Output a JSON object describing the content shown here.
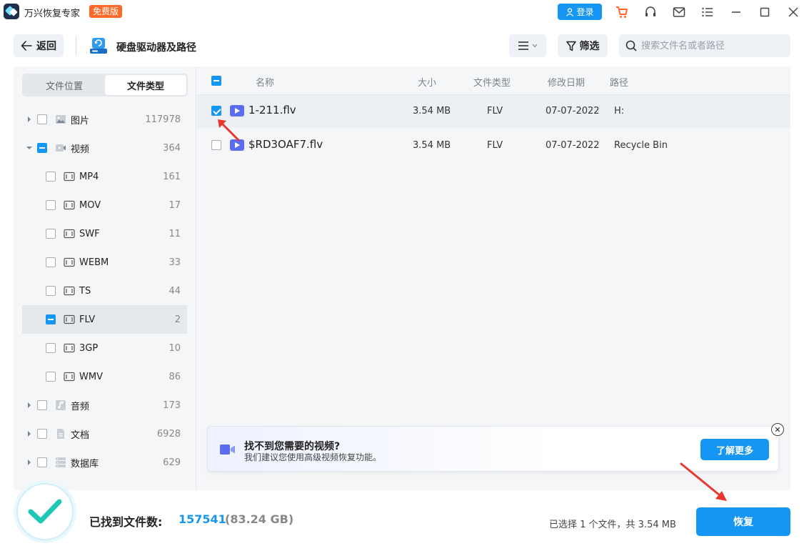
{
  "window": {
    "title": "万兴恢复专家",
    "badge": "免费版",
    "login_label": "登录"
  },
  "toolbar": {
    "back_label": "返回",
    "page_title": "硬盘驱动器及路径",
    "filter_label": "筛选",
    "search_placeholder": "搜索文件名或者路径"
  },
  "sidebar": {
    "tabs": [
      "文件位置",
      "文件类型"
    ],
    "active_tab": "文件类型",
    "tree": [
      {
        "label": "图片",
        "count": "117978",
        "level": 0,
        "state": "unchecked",
        "expanded": false,
        "icon": "image-icon"
      },
      {
        "label": "视频",
        "count": "364",
        "level": 0,
        "state": "partial",
        "expanded": true,
        "icon": "video-icon"
      },
      {
        "label": "MP4",
        "count": "161",
        "level": 1,
        "state": "unchecked",
        "icon": "video-file-icon"
      },
      {
        "label": "MOV",
        "count": "17",
        "level": 1,
        "state": "unchecked",
        "icon": "video-file-icon"
      },
      {
        "label": "SWF",
        "count": "11",
        "level": 1,
        "state": "unchecked",
        "icon": "video-file-icon"
      },
      {
        "label": "WEBM",
        "count": "33",
        "level": 1,
        "state": "unchecked",
        "icon": "video-file-icon"
      },
      {
        "label": "TS",
        "count": "44",
        "level": 1,
        "state": "unchecked",
        "icon": "video-file-icon"
      },
      {
        "label": "FLV",
        "count": "2",
        "level": 1,
        "state": "partial",
        "selected": true,
        "icon": "video-file-icon"
      },
      {
        "label": "3GP",
        "count": "10",
        "level": 1,
        "state": "unchecked",
        "icon": "video-file-icon"
      },
      {
        "label": "WMV",
        "count": "86",
        "level": 1,
        "state": "unchecked",
        "icon": "video-file-icon"
      },
      {
        "label": "音频",
        "count": "173",
        "level": 0,
        "state": "unchecked",
        "expanded": false,
        "icon": "audio-icon"
      },
      {
        "label": "文档",
        "count": "6928",
        "level": 0,
        "state": "unchecked",
        "expanded": false,
        "icon": "document-icon"
      },
      {
        "label": "数据库",
        "count": "629",
        "level": 0,
        "state": "unchecked",
        "expanded": false,
        "icon": "database-icon"
      }
    ]
  },
  "file_list": {
    "columns": [
      "名称",
      "大小",
      "文件类型",
      "修改日期",
      "路径"
    ],
    "rows": [
      {
        "name": "1-211.flv",
        "size": "3.54 MB",
        "type": "FLV",
        "date": "07-07-2022",
        "path": "H:",
        "checked": true
      },
      {
        "name": "$RD3OAF7.flv",
        "size": "3.54 MB",
        "type": "FLV",
        "date": "07-07-2022",
        "path": "Recycle Bin",
        "checked": false
      }
    ]
  },
  "banner": {
    "title": "找不到您需要的视频?",
    "subtitle": "我们建议您使用高级视频恢复功能。",
    "button_label": "了解更多",
    "close_label": "✕"
  },
  "footer": {
    "found_label": "已找到文件数:",
    "found_count": "157541",
    "found_size": "(83.24 GB)",
    "selected_info": "已选择 1 个文件，共 3.54 MB",
    "recover_label": "恢复"
  },
  "colors": {
    "accent": "#1596f2",
    "badge": "#ff6a2a",
    "video_icon": "#5b6cf2",
    "annotation": "#e8372f"
  }
}
